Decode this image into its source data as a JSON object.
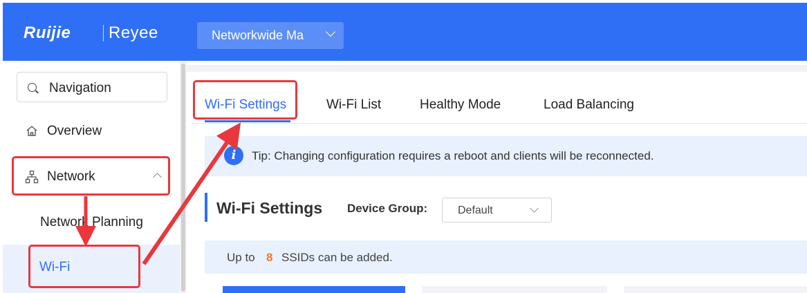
{
  "header": {
    "brand_primary": "Ruijie",
    "brand_secondary": "Reyee",
    "network_selector": "Networkwide Ma",
    "bg_color": "#2f6ff5"
  },
  "sidebar": {
    "search_label": "Navigation",
    "items": [
      {
        "label": "Overview",
        "icon": "home-icon"
      },
      {
        "label": "Network",
        "icon": "network-topology-icon",
        "expanded": true
      },
      {
        "label": "Network Planning"
      },
      {
        "label": "Wi-Fi",
        "selected": true
      }
    ]
  },
  "tabs": [
    {
      "label": "Wi-Fi Settings",
      "active": true
    },
    {
      "label": "Wi-Fi List"
    },
    {
      "label": "Healthy Mode"
    },
    {
      "label": "Load Balancing"
    }
  ],
  "tip": {
    "icon": "info-icon",
    "text": "Tip: Changing configuration requires a reboot and clients will be reconnected."
  },
  "section": {
    "title": "Wi-Fi Settings",
    "device_group_label": "Device Group:",
    "device_group_value": "Default"
  },
  "ssid_info": {
    "prefix": "Up to",
    "count": "8",
    "suffix": "SSIDs can be added."
  },
  "annotation_color": "#e8383d"
}
